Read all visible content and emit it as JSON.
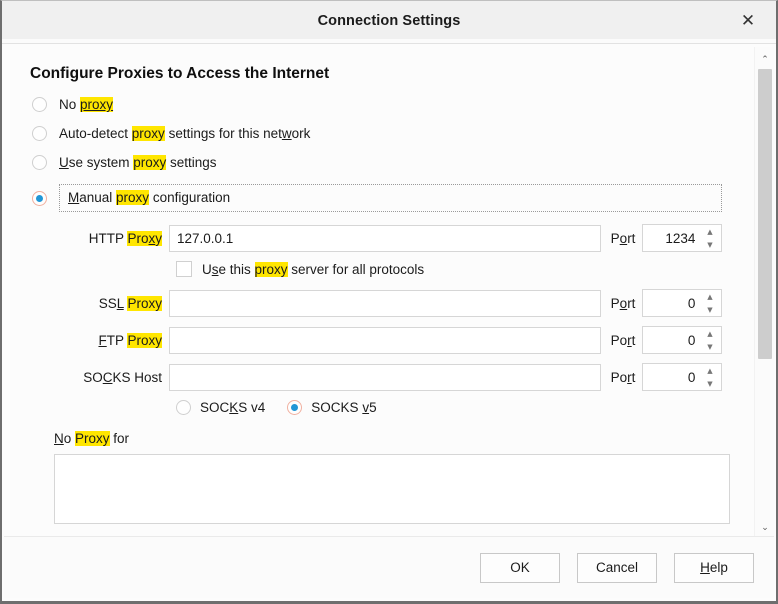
{
  "window": {
    "title": "Connection Settings",
    "close_icon": "close-icon",
    "close_glyph": "✕"
  },
  "main": {
    "heading": "Configure Proxies to Access the Internet",
    "proxy_mode": {
      "options": [
        {
          "label": "No proxy",
          "pre": "No ",
          "hl": "proxy",
          "post": "",
          "selected": false
        },
        {
          "label": "Auto-detect proxy settings for this network",
          "pre": "Auto-detect ",
          "hl": "proxy",
          "post": " settings for this network",
          "selected": false
        },
        {
          "label": "Use system proxy settings",
          "pre": "Use system ",
          "hl": "proxy",
          "post": " settings",
          "selected": false
        },
        {
          "label": "Manual proxy configuration",
          "pre": "Manual ",
          "hl": "proxy",
          "post": " configuration",
          "selected": true
        }
      ]
    },
    "fields": {
      "http": {
        "label_pre": "HTTP ",
        "label_hl": "Proxy",
        "value": "127.0.0.1",
        "port_label": "Port",
        "port_value": "1234"
      },
      "ssl": {
        "label_pre": "SSL ",
        "label_hl": "Proxy",
        "value": "",
        "port_label": "Port",
        "port_value": "0"
      },
      "ftp": {
        "label_pre": "FTP ",
        "label_hl": "Proxy",
        "value": "",
        "port_label": "Port",
        "port_value": "0"
      },
      "socks": {
        "label_pre": "SOCKS Host",
        "label_hl": "",
        "value": "",
        "port_label": "Port",
        "port_value": "0"
      }
    },
    "all_protocols": {
      "pre": "Use this ",
      "hl": "proxy",
      "post": " server for all protocols",
      "checked": false
    },
    "socks_version": {
      "v4_label": "SOCKS v4",
      "v5_label": "SOCKS v5",
      "selected": "SOCKS v5"
    },
    "no_proxy_for": {
      "pre": "No ",
      "hl": "Proxy",
      "post": " for",
      "value": "",
      "placeholder": ""
    }
  },
  "footer": {
    "ok_label": "OK",
    "cancel_label": "Cancel",
    "help_label": "Help"
  },
  "scrollbar": {
    "up_glyph": "⌃",
    "down_glyph": "⌄"
  },
  "colors": {
    "highlight": "#ffe600",
    "radio_selected": "#2196d6",
    "titlebar_bg": "#f0f0f0",
    "window_border": "#6e6e6e"
  }
}
